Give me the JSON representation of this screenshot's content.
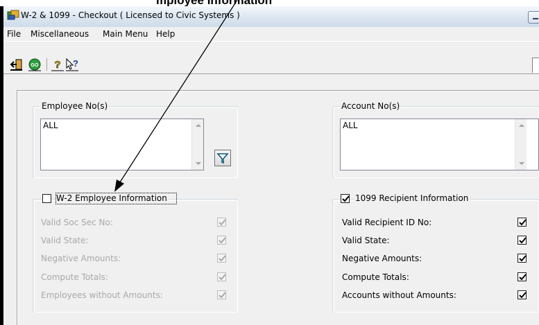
{
  "annotation": {
    "top_text": "mployee Information"
  },
  "window": {
    "title": "W-2 & 1099 - Checkout    ( Licensed to Civic Systems )"
  },
  "menu": [
    "File",
    "Miscellaneous",
    "Main Menu",
    "Help"
  ],
  "toolbar": {
    "buttons": [
      "exit-icon",
      "go-icon",
      "help-icon",
      "context-help-icon"
    ]
  },
  "employee": {
    "legend": "Employee No(s)",
    "value": "ALL"
  },
  "account": {
    "legend": "Account No(s)",
    "value": "ALL"
  },
  "w2": {
    "legend": "W-2 Employee Information",
    "enabled": false,
    "rows": [
      {
        "label": "Valid Soc Sec No:",
        "checked": true
      },
      {
        "label": "Valid State:",
        "checked": true
      },
      {
        "label": "Negative Amounts:",
        "checked": true
      },
      {
        "label": "Compute Totals:",
        "checked": true
      },
      {
        "label": "Employees without Amounts:",
        "checked": true
      }
    ]
  },
  "r1099": {
    "legend": "1099 Recipient Information",
    "enabled": true,
    "rows": [
      {
        "label": "Valid Recipient ID No:",
        "checked": true
      },
      {
        "label": "Valid State:",
        "checked": true
      },
      {
        "label": "Negative Amounts:",
        "checked": true
      },
      {
        "label": "Compute Totals:",
        "checked": true
      },
      {
        "label": "Accounts without Amounts:",
        "checked": true
      }
    ]
  }
}
